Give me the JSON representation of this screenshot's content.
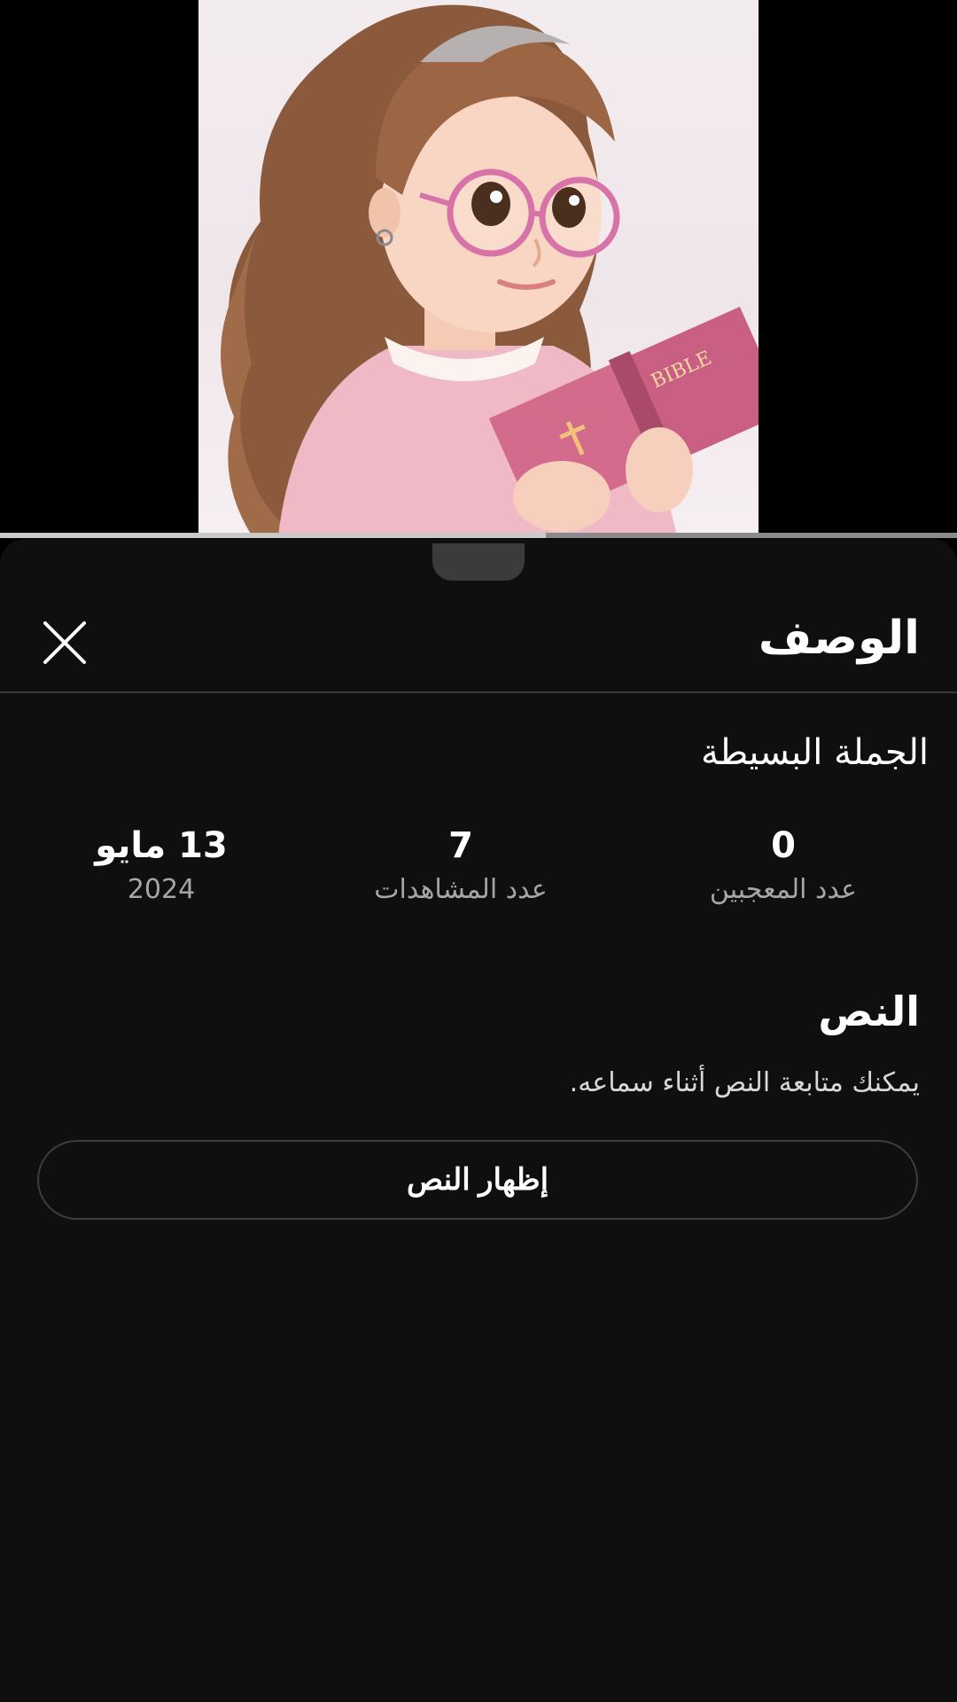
{
  "player": {
    "thumbnail_icon": "animated-girl-reading-bible-image",
    "book_cover_text": "BIBLE",
    "progress": 0.57
  },
  "sheet": {
    "title": "الوصف",
    "close_icon": "close-icon",
    "video_title": "الجملة البسيطة",
    "stats": {
      "likes": {
        "value": "0",
        "label": "عدد المعجبين"
      },
      "views": {
        "value": "7",
        "label": "عدد المشاهدات"
      },
      "date": {
        "value": "13 مايو",
        "label": "2024"
      }
    },
    "transcript": {
      "title": "النص",
      "description": "يمكنك متابعة النص أثناء سماعه.",
      "button_label": "إظهار النص"
    }
  },
  "colors": {
    "sheet_background": "#0f0f0f",
    "divider": "#3a3a3a",
    "secondary_text": "#a6a6a6"
  }
}
